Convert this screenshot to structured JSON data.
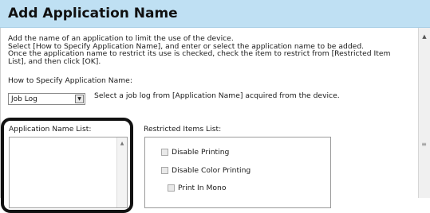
{
  "header": {
    "title": "Add Application Name"
  },
  "description": {
    "lines": [
      "Add the name of an application to limit the use of the device.",
      "Select [How to Specify Application Name], and enter or select the application name to be added.",
      "Once the application name to restrict its use is checked, check the item to restrict from [Restricted Item",
      "List], and then click [OK]."
    ]
  },
  "how_to": {
    "label": "How to Specify Application Name:",
    "selected": "Job Log",
    "hint": "Select a job log from [Application Name] acquired from the device."
  },
  "app_list": {
    "label": "Application Name List:"
  },
  "restricted": {
    "label": "Restricted Items List:",
    "items": [
      {
        "label": "Disable Printing",
        "checked": false
      },
      {
        "label": "Disable Color Printing",
        "checked": false
      },
      {
        "label": "Print In Mono",
        "checked": false
      }
    ]
  },
  "icons": {
    "dropdown": "chevron-down-icon",
    "scroll_up": "scroll-up-arrow-icon",
    "scroll_grip": "scroll-grip-icon"
  },
  "colors": {
    "header_bg": "#bfe0f3",
    "highlight_border": "#111111"
  }
}
